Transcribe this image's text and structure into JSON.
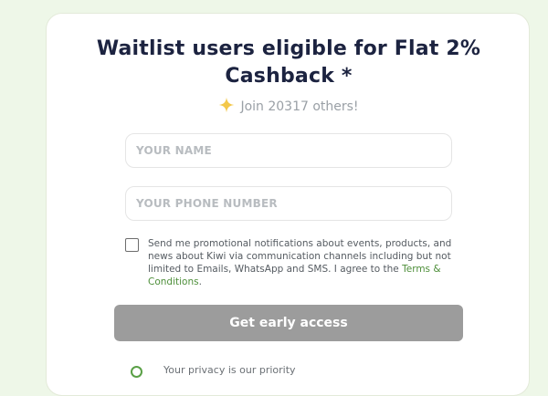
{
  "signup": {
    "title_line1": "Waitlist users eligible for Flat 2%",
    "title_line2": "Cashback *",
    "join_text": "Join 20317 others!",
    "name_placeholder": "YOUR NAME",
    "phone_placeholder": "YOUR PHONE NUMBER",
    "consent_text": "Send me promotional notifications about events, products, and news about Kiwi via communication channels including but not limited to Emails, WhatsApp and SMS. I agree to the ",
    "terms_label": "Terms & Conditions",
    "consent_end": ".",
    "cta_label": "Get early access",
    "privacy_text": "Your privacy is our priority"
  },
  "colors": {
    "page_background": "#eef7e8",
    "title": "#1c2340",
    "sparkle": "#f3c84a",
    "link": "#4e8f3a",
    "button_disabled": "#9c9c9c"
  },
  "icons": {
    "join": "sparkle-icon",
    "privacy": "shield-check-icon"
  }
}
